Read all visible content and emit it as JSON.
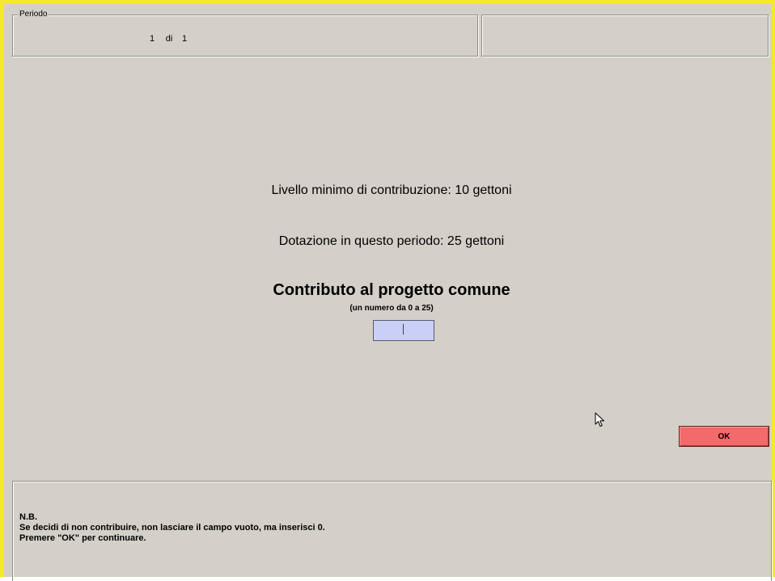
{
  "header": {
    "period_legend": "Periodo",
    "period_current": "1",
    "period_of": "di",
    "period_total": "1"
  },
  "main": {
    "min_contribution_text": "Livello minimo di contribuzione: 10 gettoni",
    "endowment_text": "Dotazione in questo periodo: 25 gettoni",
    "contribution_title": "Contributo al progetto comune",
    "contribution_hint": "(un numero da 0 a 25)",
    "contribution_value": ""
  },
  "actions": {
    "ok_label": "OK"
  },
  "notes": {
    "heading": "N.B.",
    "line1": "Se decidi di non contribuire, non lasciare il campo vuoto, ma inserisci 0.",
    "line2": "Premere \"OK\" per continuare."
  },
  "colors": {
    "frame_border": "#f4ea2a",
    "background": "#d4d0c8",
    "input_background": "#c9cff7",
    "ok_button": "#f26a6a"
  },
  "icons": {
    "cursor": "mouse-pointer-icon"
  }
}
